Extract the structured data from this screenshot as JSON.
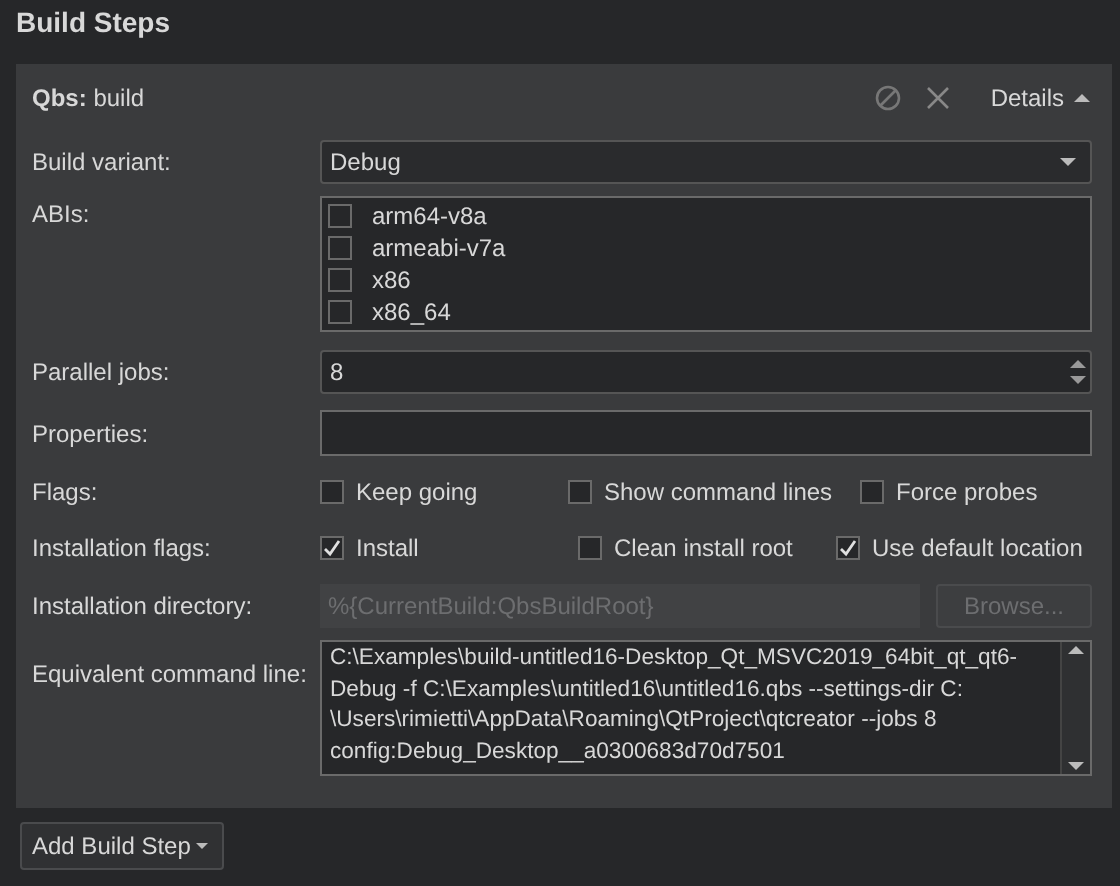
{
  "title": "Build Steps",
  "step": {
    "prefix": "Qbs:",
    "name": "build",
    "details": "Details",
    "expanded": true
  },
  "build_variant": {
    "label": "Build variant:",
    "value": "Debug"
  },
  "abis": {
    "label": "ABIs:",
    "items": [
      {
        "label": "arm64-v8a",
        "checked": false
      },
      {
        "label": "armeabi-v7a",
        "checked": false
      },
      {
        "label": "x86",
        "checked": false
      },
      {
        "label": "x86_64",
        "checked": false
      }
    ]
  },
  "parallel_jobs": {
    "label": "Parallel jobs:",
    "value": "8"
  },
  "properties": {
    "label": "Properties:"
  },
  "flags": {
    "label": "Flags:",
    "items": [
      {
        "label": "Keep going",
        "checked": false
      },
      {
        "label": "Show command lines",
        "checked": false
      },
      {
        "label": "Force probes",
        "checked": false
      }
    ]
  },
  "installation_flags": {
    "label": "Installation flags:",
    "items": [
      {
        "label": "Install",
        "checked": true
      },
      {
        "label": "Clean install root",
        "checked": false
      },
      {
        "label": "Use default location",
        "checked": true
      }
    ]
  },
  "installation_directory": {
    "label": "Installation directory:",
    "placeholder": "%{CurrentBuild:QbsBuildRoot}",
    "disabled": true,
    "button": "Browse..."
  },
  "command_line": {
    "label": "Equivalent command line:",
    "lines": [
      "C:\\Examples\\build-untitled16-Desktop_Qt_MSVC2019_64bit_qt_qt6-",
      "Debug -f C:\\Examples\\untitled16\\untitled16.qbs --settings-dir C:",
      "\\Users\\rimietti\\AppData\\Roaming\\QtProject\\qtcreator --jobs 8",
      "config:Debug_Desktop__a0300683d70d7501"
    ]
  },
  "add_button": "Add Build Step"
}
